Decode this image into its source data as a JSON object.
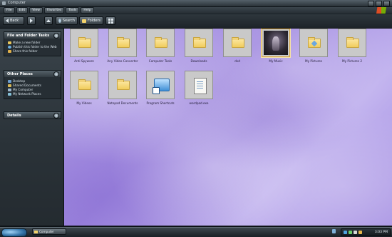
{
  "window": {
    "title": "Computer"
  },
  "menu": [
    "File",
    "Edit",
    "View",
    "Favorites",
    "Tools",
    "Help"
  ],
  "toolbar": {
    "back_label": "Back",
    "search_label": "Search",
    "folders_label": "Folders"
  },
  "tasks_panel": {
    "title": "File and Folder Tasks",
    "items": [
      {
        "label": "Make a new folder",
        "icon": "new-folder-icon"
      },
      {
        "label": "Publish this folder to the Web",
        "icon": "web-publish-icon"
      },
      {
        "label": "Share this folder",
        "icon": "share-icon"
      }
    ]
  },
  "places_panel": {
    "title": "Other Places",
    "items": [
      {
        "label": "Desktop",
        "icon": "desktop-icon"
      },
      {
        "label": "Shared Documents",
        "icon": "shared-docs-icon"
      },
      {
        "label": "My Computer",
        "icon": "computer-icon"
      },
      {
        "label": "My Network Places",
        "icon": "network-icon"
      }
    ]
  },
  "details_panel": {
    "title": "Details"
  },
  "files": [
    {
      "label": "Anti Spyware",
      "type": "folder"
    },
    {
      "label": "Any Video Converter",
      "type": "folder"
    },
    {
      "label": "Computer Tools",
      "type": "folder"
    },
    {
      "label": "Downloads",
      "type": "folder"
    },
    {
      "label": "dvd",
      "type": "folder"
    },
    {
      "label": "My Music",
      "type": "music-folder",
      "selected": true
    },
    {
      "label": "My Pictures",
      "type": "pictures-folder"
    },
    {
      "label": "My Pictures 2",
      "type": "folder"
    },
    {
      "label": "My Videos",
      "type": "folder"
    },
    {
      "label": "Notepad Documents",
      "type": "folder"
    },
    {
      "label": "Program Shortcuts",
      "type": "shortcut-folder"
    },
    {
      "label": "wordpad.exe",
      "type": "document"
    }
  ],
  "taskbar": {
    "task_label": "Computer",
    "clock": "3:03 PM"
  },
  "colors": {
    "content_bg": "#b7a6ea",
    "chrome_dark": "#1b2227",
    "folder": "#f1cd5c",
    "selected_border": "#d9a640"
  }
}
